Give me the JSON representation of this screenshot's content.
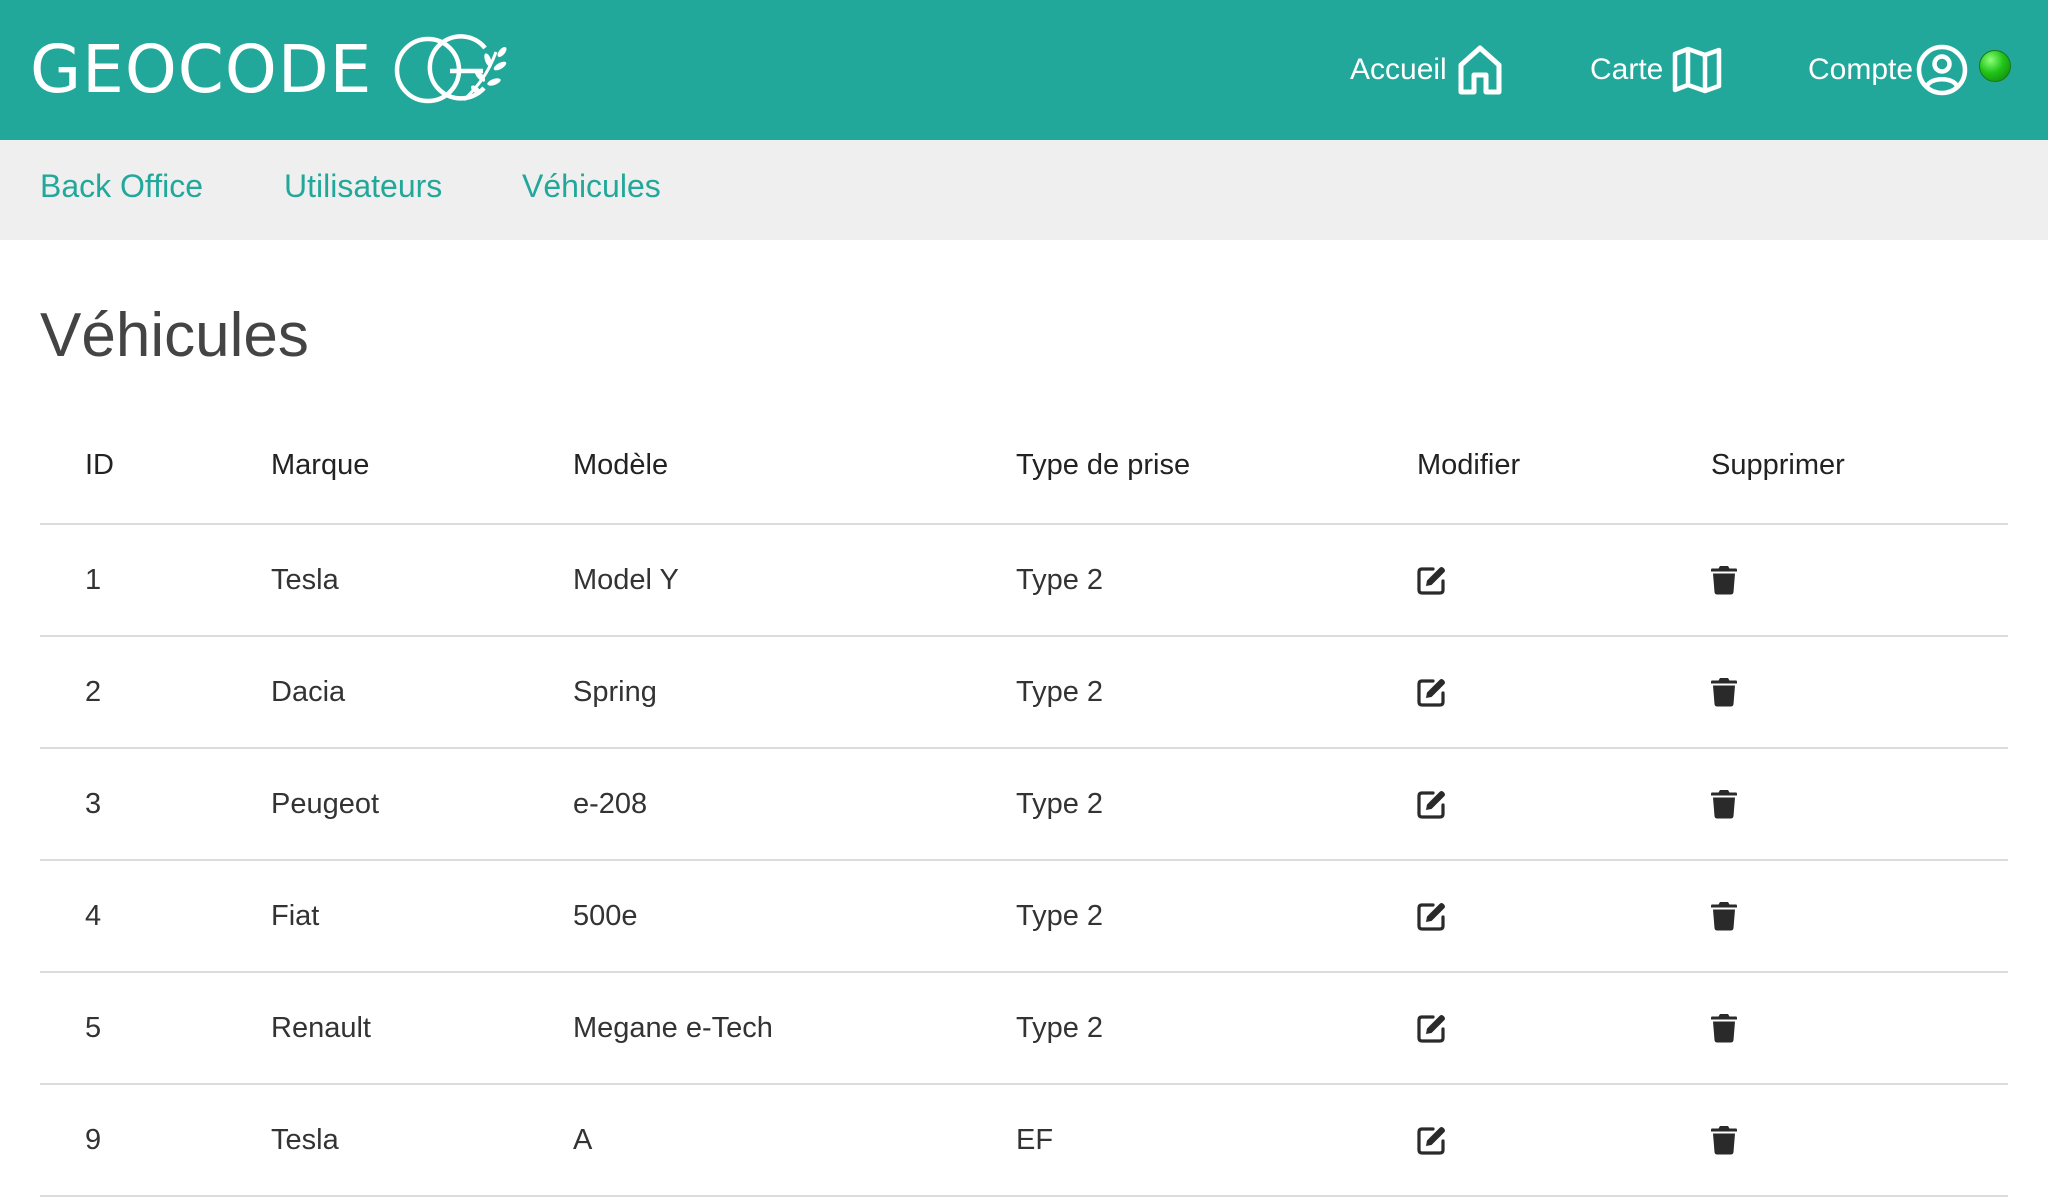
{
  "header": {
    "brand": "GEOCODE",
    "logo_icon": "geocode-leaf-logo",
    "background_color": "#22a89a",
    "nav": [
      {
        "label": "Accueil",
        "icon": "home-icon"
      },
      {
        "label": "Carte",
        "icon": "map-icon"
      },
      {
        "label": "Compte",
        "icon": "user-circle-icon"
      }
    ],
    "status_color": "#21c41a"
  },
  "subnav": {
    "items": [
      {
        "label": "Back Office"
      },
      {
        "label": "Utilisateurs"
      },
      {
        "label": "Véhicules"
      }
    ],
    "background_color": "#efefef",
    "link_color": "#22a89a"
  },
  "page": {
    "title": "Véhicules"
  },
  "table": {
    "columns": [
      "ID",
      "Marque",
      "Modèle",
      "Type de prise",
      "Modifier",
      "Supprimer"
    ],
    "rows": [
      {
        "id": "1",
        "brand": "Tesla",
        "model": "Model Y",
        "plug": "Type 2"
      },
      {
        "id": "2",
        "brand": "Dacia",
        "model": "Spring",
        "plug": "Type 2"
      },
      {
        "id": "3",
        "brand": "Peugeot",
        "model": "e-208",
        "plug": "Type 2"
      },
      {
        "id": "4",
        "brand": "Fiat",
        "model": "500e",
        "plug": "Type 2"
      },
      {
        "id": "5",
        "brand": "Renault",
        "model": "Megane e-Tech",
        "plug": "Type 2"
      },
      {
        "id": "9",
        "brand": "Tesla",
        "model": "A",
        "plug": "EF"
      }
    ],
    "edit_icon": "edit-icon",
    "delete_icon": "trash-icon"
  }
}
